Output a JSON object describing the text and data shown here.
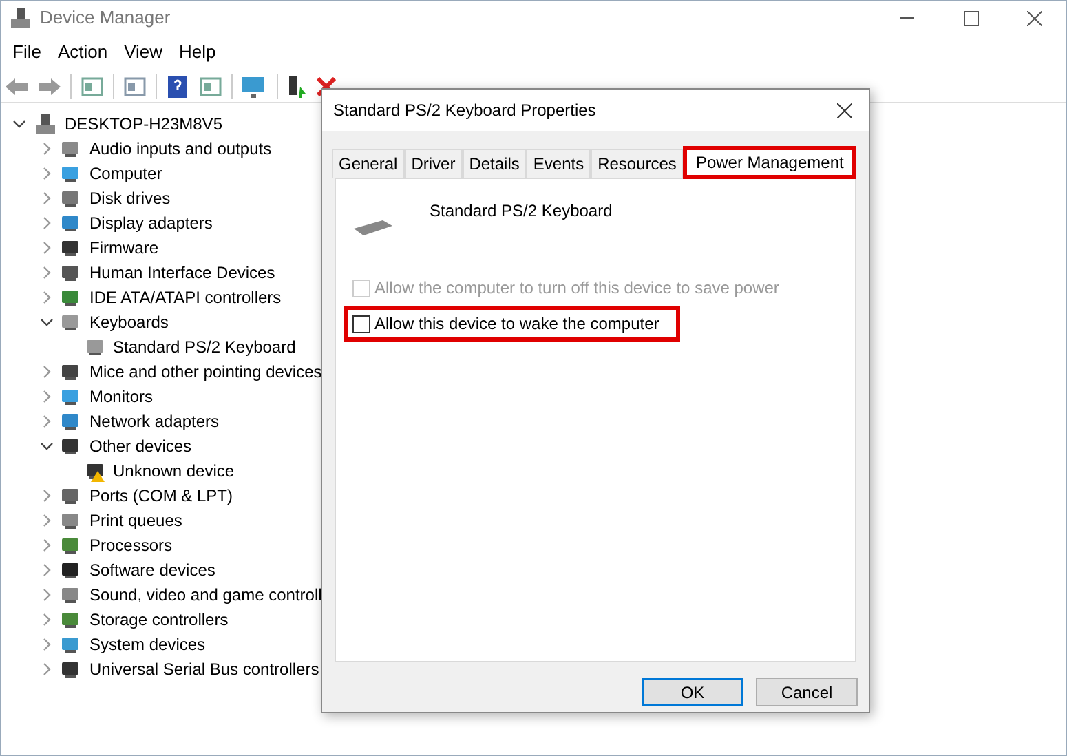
{
  "window": {
    "title": "Device Manager"
  },
  "menu": [
    "File",
    "Action",
    "View",
    "Help"
  ],
  "tree": {
    "label": "DESKTOP-H23M8V5",
    "expanded": true,
    "children": [
      {
        "label": "Audio inputs and outputs",
        "expanded": false
      },
      {
        "label": "Computer",
        "expanded": false
      },
      {
        "label": "Disk drives",
        "expanded": false
      },
      {
        "label": "Display adapters",
        "expanded": false
      },
      {
        "label": "Firmware",
        "expanded": false
      },
      {
        "label": "Human Interface Devices",
        "expanded": false
      },
      {
        "label": "IDE ATA/ATAPI controllers",
        "expanded": false
      },
      {
        "label": "Keyboards",
        "expanded": true,
        "children": [
          {
            "label": "Standard PS/2 Keyboard"
          }
        ]
      },
      {
        "label": "Mice and other pointing devices",
        "expanded": false
      },
      {
        "label": "Monitors",
        "expanded": false
      },
      {
        "label": "Network adapters",
        "expanded": false
      },
      {
        "label": "Other devices",
        "expanded": true,
        "children": [
          {
            "label": "Unknown device"
          }
        ]
      },
      {
        "label": "Ports (COM & LPT)",
        "expanded": false
      },
      {
        "label": "Print queues",
        "expanded": false
      },
      {
        "label": "Processors",
        "expanded": false
      },
      {
        "label": "Software devices",
        "expanded": false
      },
      {
        "label": "Sound, video and game controll",
        "expanded": false
      },
      {
        "label": "Storage controllers",
        "expanded": false
      },
      {
        "label": "System devices",
        "expanded": false
      },
      {
        "label": "Universal Serial Bus controllers",
        "expanded": false
      }
    ]
  },
  "dialog": {
    "title": "Standard PS/2 Keyboard Properties",
    "tabs": [
      {
        "label": "General",
        "selected": false,
        "highlighted": false
      },
      {
        "label": "Driver",
        "selected": false,
        "highlighted": false
      },
      {
        "label": "Details",
        "selected": false,
        "highlighted": false
      },
      {
        "label": "Events",
        "selected": false,
        "highlighted": false
      },
      {
        "label": "Resources",
        "selected": false,
        "highlighted": false
      },
      {
        "label": "Power Management",
        "selected": true,
        "highlighted": true
      }
    ],
    "device_name": "Standard PS/2 Keyboard",
    "options": [
      {
        "label": "Allow the computer to turn off this device to save power",
        "checked": false,
        "disabled": true,
        "highlighted": false
      },
      {
        "label": "Allow this device to wake the computer",
        "checked": false,
        "disabled": false,
        "highlighted": true
      }
    ],
    "buttons": [
      {
        "label": "OK",
        "default": true
      },
      {
        "label": "Cancel",
        "default": false
      }
    ]
  }
}
